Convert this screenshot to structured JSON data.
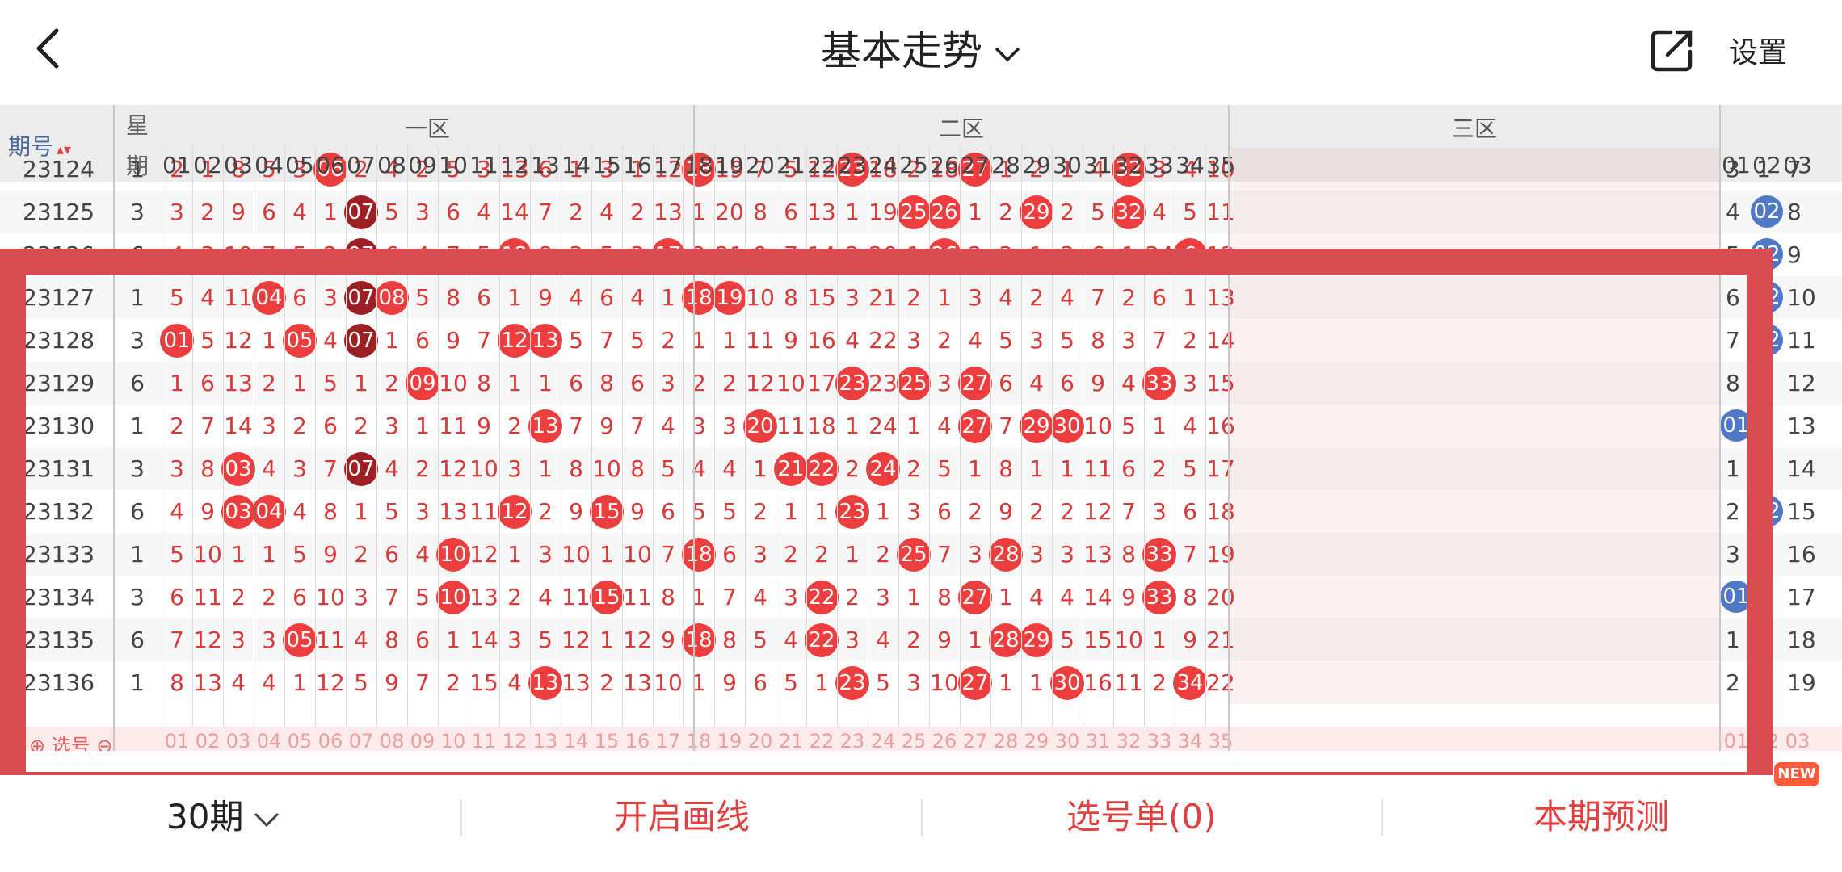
{
  "header": {
    "title": "基本走势",
    "settings_label": "设置"
  },
  "table": {
    "issue_header": "期号",
    "weekday_header_top": "星",
    "weekday_header_bottom": "期",
    "zones": [
      "一区",
      "二区",
      "三区"
    ],
    "red_columns": [
      "01",
      "02",
      "03",
      "04",
      "05",
      "06",
      "07",
      "08",
      "09",
      "10",
      "11",
      "12",
      "13",
      "14",
      "15",
      "16",
      "17",
      "18",
      "19",
      "20",
      "21",
      "22",
      "23",
      "24",
      "25",
      "26",
      "27",
      "28",
      "29",
      "30",
      "31",
      "32",
      "33",
      "34",
      "35"
    ],
    "blue_columns": [
      "01",
      "02",
      "03"
    ],
    "rows": [
      {
        "issue": "23124",
        "weekday": "1",
        "cells": [
          "2",
          "1",
          "8",
          "5",
          "3",
          "06",
          "2",
          "4",
          "2",
          "5",
          "3",
          "13",
          "6",
          "1",
          "3",
          "1",
          "12",
          "18",
          "19",
          "7",
          "5",
          "12",
          "23",
          "18",
          "2",
          "18",
          "27",
          "1",
          "2",
          "1",
          "4",
          "32",
          "3",
          "4",
          "10"
        ],
        "hits": [
          6,
          18,
          23,
          27,
          32
        ],
        "blue": [
          "3",
          "1",
          "7"
        ]
      },
      {
        "issue": "23125",
        "weekday": "3",
        "cells": [
          "3",
          "2",
          "9",
          "6",
          "4",
          "1",
          "07",
          "5",
          "3",
          "6",
          "4",
          "14",
          "7",
          "2",
          "4",
          "2",
          "13",
          "1",
          "20",
          "8",
          "6",
          "13",
          "1",
          "19",
          "25",
          "26",
          "1",
          "2",
          "29",
          "2",
          "5",
          "32",
          "4",
          "5",
          "11"
        ],
        "hits": [
          7,
          25,
          26,
          29,
          32
        ],
        "blue": [
          "4",
          "02",
          "8"
        ]
      },
      {
        "issue": "23126",
        "weekday": "6",
        "cells": [
          "4",
          "3",
          "10",
          "7",
          "5",
          "2",
          "07",
          "6",
          "4",
          "7",
          "5",
          "12",
          "8",
          "3",
          "5",
          "3",
          "17",
          "2",
          "21",
          "9",
          "7",
          "14",
          "2",
          "20",
          "1",
          "26",
          "2",
          "3",
          "1",
          "3",
          "6",
          "1",
          "34",
          "6",
          "12"
        ],
        "hits": [
          7,
          12,
          17,
          26,
          34
        ],
        "blue": [
          "5",
          "02",
          "9"
        ]
      },
      {
        "issue": "23127",
        "weekday": "1",
        "cells": [
          "5",
          "4",
          "11",
          "04",
          "6",
          "3",
          "07",
          "08",
          "5",
          "8",
          "6",
          "1",
          "9",
          "4",
          "6",
          "4",
          "1",
          "18",
          "19",
          "10",
          "8",
          "15",
          "3",
          "21",
          "2",
          "1",
          "3",
          "4",
          "2",
          "4",
          "7",
          "2",
          "6",
          "1",
          "13"
        ],
        "hits": [
          4,
          7,
          8,
          18,
          19
        ],
        "blue": [
          "6",
          "02",
          "10"
        ]
      },
      {
        "issue": "23128",
        "weekday": "3",
        "cells": [
          "01",
          "5",
          "12",
          "1",
          "05",
          "4",
          "07",
          "1",
          "6",
          "9",
          "7",
          "12",
          "13",
          "5",
          "7",
          "5",
          "2",
          "1",
          "1",
          "11",
          "9",
          "16",
          "4",
          "22",
          "3",
          "2",
          "4",
          "5",
          "3",
          "5",
          "8",
          "3",
          "7",
          "2",
          "14"
        ],
        "hits": [
          1,
          5,
          7,
          12,
          13
        ],
        "blue": [
          "7",
          "02",
          "11"
        ]
      },
      {
        "issue": "23129",
        "weekday": "6",
        "cells": [
          "1",
          "6",
          "13",
          "2",
          "1",
          "5",
          "1",
          "2",
          "09",
          "10",
          "8",
          "1",
          "1",
          "6",
          "8",
          "6",
          "3",
          "2",
          "2",
          "12",
          "10",
          "17",
          "23",
          "23",
          "25",
          "3",
          "27",
          "6",
          "4",
          "6",
          "9",
          "4",
          "33",
          "3",
          "15"
        ],
        "hits": [
          9,
          23,
          25,
          27,
          33
        ],
        "blue": [
          "8",
          "1",
          "12"
        ]
      },
      {
        "issue": "23130",
        "weekday": "1",
        "cells": [
          "2",
          "7",
          "14",
          "3",
          "2",
          "6",
          "2",
          "3",
          "1",
          "11",
          "9",
          "2",
          "13",
          "7",
          "9",
          "7",
          "4",
          "3",
          "3",
          "20",
          "11",
          "18",
          "1",
          "24",
          "1",
          "4",
          "27",
          "7",
          "29",
          "30",
          "10",
          "5",
          "1",
          "4",
          "16"
        ],
        "hits": [
          13,
          20,
          27,
          29,
          30
        ],
        "blue": [
          "01",
          "2",
          "13"
        ]
      },
      {
        "issue": "23131",
        "weekday": "3",
        "cells": [
          "3",
          "8",
          "03",
          "4",
          "3",
          "7",
          "07",
          "4",
          "2",
          "12",
          "10",
          "3",
          "1",
          "8",
          "10",
          "8",
          "5",
          "4",
          "4",
          "1",
          "21",
          "22",
          "2",
          "24",
          "2",
          "5",
          "1",
          "8",
          "1",
          "1",
          "11",
          "6",
          "2",
          "5",
          "17"
        ],
        "hits": [
          3,
          7,
          21,
          22,
          24
        ],
        "blue": [
          "1",
          "3",
          "14"
        ]
      },
      {
        "issue": "23132",
        "weekday": "6",
        "cells": [
          "4",
          "9",
          "03",
          "04",
          "4",
          "8",
          "1",
          "5",
          "3",
          "13",
          "11",
          "12",
          "2",
          "9",
          "15",
          "9",
          "6",
          "5",
          "5",
          "2",
          "1",
          "1",
          "23",
          "1",
          "3",
          "6",
          "2",
          "9",
          "2",
          "2",
          "12",
          "7",
          "3",
          "6",
          "18"
        ],
        "hits": [
          3,
          4,
          12,
          15,
          23
        ],
        "blue": [
          "2",
          "02",
          "15"
        ]
      },
      {
        "issue": "23133",
        "weekday": "1",
        "cells": [
          "5",
          "10",
          "1",
          "1",
          "5",
          "9",
          "2",
          "6",
          "4",
          "10",
          "12",
          "1",
          "3",
          "10",
          "1",
          "10",
          "7",
          "18",
          "6",
          "3",
          "2",
          "2",
          "1",
          "2",
          "25",
          "7",
          "3",
          "28",
          "3",
          "3",
          "13",
          "8",
          "33",
          "7",
          "19"
        ],
        "hits": [
          10,
          18,
          25,
          28,
          33
        ],
        "blue": [
          "3",
          "1",
          "16"
        ]
      },
      {
        "issue": "23134",
        "weekday": "3",
        "cells": [
          "6",
          "11",
          "2",
          "2",
          "6",
          "10",
          "3",
          "7",
          "5",
          "10",
          "13",
          "2",
          "4",
          "11",
          "15",
          "11",
          "8",
          "1",
          "7",
          "4",
          "3",
          "22",
          "2",
          "3",
          "1",
          "8",
          "27",
          "1",
          "4",
          "4",
          "14",
          "9",
          "33",
          "8",
          "20"
        ],
        "hits": [
          10,
          15,
          22,
          27,
          33
        ],
        "blue": [
          "01",
          "2",
          "17"
        ]
      },
      {
        "issue": "23135",
        "weekday": "6",
        "cells": [
          "7",
          "12",
          "3",
          "3",
          "05",
          "11",
          "4",
          "8",
          "6",
          "1",
          "14",
          "3",
          "5",
          "12",
          "1",
          "12",
          "9",
          "18",
          "8",
          "5",
          "4",
          "22",
          "3",
          "4",
          "2",
          "9",
          "1",
          "28",
          "29",
          "5",
          "15",
          "10",
          "1",
          "9",
          "21"
        ],
        "hits": [
          5,
          18,
          22,
          28,
          29
        ],
        "blue": [
          "1",
          "3",
          "18"
        ]
      },
      {
        "issue": "23136",
        "weekday": "1",
        "cells": [
          "8",
          "13",
          "4",
          "4",
          "1",
          "12",
          "5",
          "9",
          "7",
          "2",
          "15",
          "4",
          "13",
          "13",
          "2",
          "13",
          "10",
          "1",
          "9",
          "6",
          "5",
          "1",
          "23",
          "5",
          "3",
          "10",
          "27",
          "1",
          "1",
          "30",
          "16",
          "11",
          "2",
          "34",
          "22"
        ],
        "hits": [
          13,
          23,
          27,
          30,
          34
        ],
        "blue": [
          "2",
          "4",
          "19"
        ]
      }
    ],
    "select_label": "选号"
  },
  "bottom_bar": {
    "period": "30期",
    "draw_lines": "开启画线",
    "slip": "选号单(0)",
    "predict": "本期预测",
    "new_badge": "NEW"
  },
  "colors": {
    "ball_red": "#ec3e3e",
    "ball_dark": "#9c1f23",
    "ball_blue": "#4f78c6",
    "frame": "#d94c52"
  }
}
